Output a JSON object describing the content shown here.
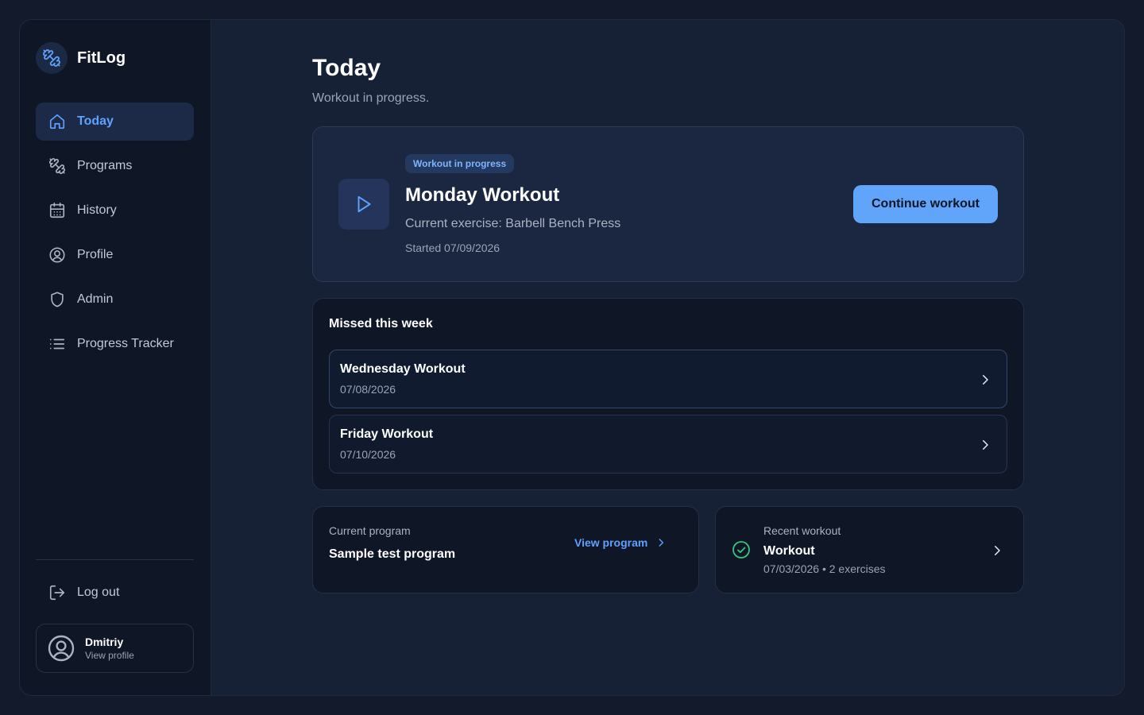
{
  "brand": {
    "name": "FitLog",
    "icon": "dumbbell-icon"
  },
  "sidebar": {
    "items": [
      {
        "label": "Today",
        "icon": "home-icon",
        "active": true
      },
      {
        "label": "Programs",
        "icon": "dumbbell-icon"
      },
      {
        "label": "History",
        "icon": "calendar-icon"
      },
      {
        "label": "Profile",
        "icon": "user-circle-icon"
      },
      {
        "label": "Admin",
        "icon": "shield-icon"
      },
      {
        "label": "Progress Tracker",
        "icon": "list-icon"
      }
    ],
    "logout_label": "Log out",
    "user": {
      "name": "Dmitriy",
      "sub": "View profile"
    }
  },
  "page": {
    "title": "Today",
    "subtitle": "Workout in progress."
  },
  "hero": {
    "badge": "Workout in progress",
    "title": "Monday Workout",
    "exercise": "Current exercise: Barbell Bench Press",
    "started": "Started 07/09/2026",
    "button": "Continue workout"
  },
  "missed": {
    "title": "Missed this week",
    "items": [
      {
        "name": "Wednesday Workout",
        "date": "07/08/2026"
      },
      {
        "name": "Friday Workout",
        "date": "07/10/2026"
      }
    ]
  },
  "program": {
    "label": "Current program",
    "name": "Sample test program",
    "link": "View program"
  },
  "recent": {
    "label": "Recent workout",
    "name": "Workout",
    "meta": "07/03/2026 • 2 exercises"
  },
  "colors": {
    "accent": "#60a5fa",
    "success": "#34c77b",
    "background": "#121a2b"
  }
}
